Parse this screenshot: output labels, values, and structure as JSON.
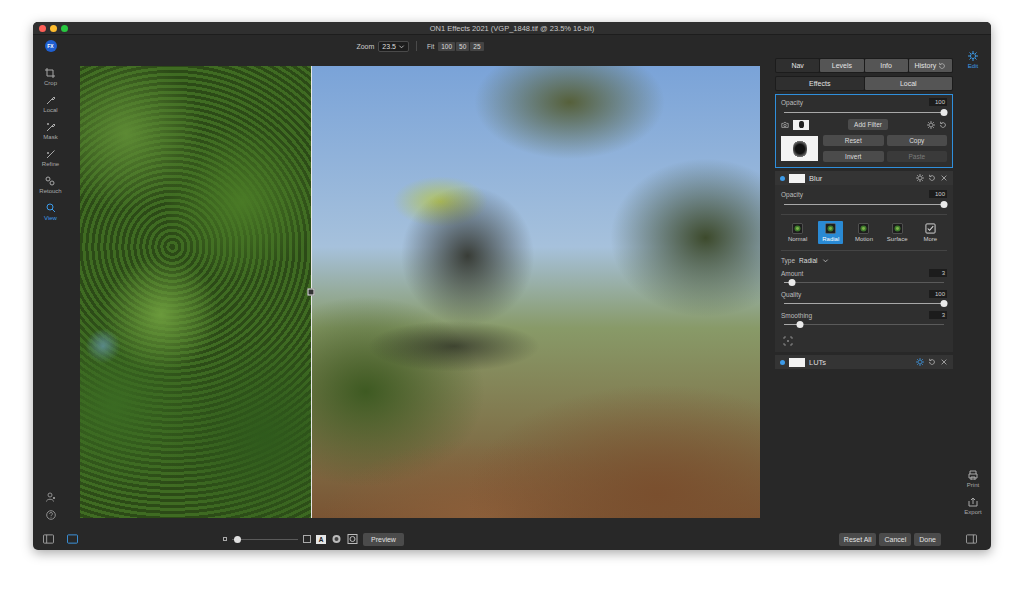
{
  "window": {
    "title": "ON1 Effects 2021 (VGP_1848.tif @ 23.5% 16-bit)"
  },
  "logo": "FX",
  "toolbar": {
    "zoom_label": "Zoom",
    "zoom_value": "23.5",
    "fit_label": "Fit",
    "presets": [
      "100",
      "50",
      "25"
    ]
  },
  "tools": [
    {
      "label": "Crop",
      "selected": false
    },
    {
      "label": "Local",
      "selected": false
    },
    {
      "label": "Mask",
      "selected": false
    },
    {
      "label": "Refine",
      "selected": false
    },
    {
      "label": "Retouch",
      "selected": false
    },
    {
      "label": "View",
      "selected": true
    }
  ],
  "modules": [
    {
      "label": "Edit",
      "selected": true
    },
    {
      "label": "Print",
      "selected": false
    },
    {
      "label": "Export",
      "selected": false
    }
  ],
  "photo": {
    "split_level": 0.34
  },
  "panel_tabs": [
    {
      "label": "Nav",
      "selected": true
    },
    {
      "label": "Levels",
      "selected": false
    },
    {
      "label": "Info",
      "selected": false
    },
    {
      "label": "History",
      "selected": false
    }
  ],
  "mode_tabs": [
    {
      "label": "Effects",
      "selected": true
    },
    {
      "label": "Local",
      "selected": false
    }
  ],
  "master": {
    "opacity": {
      "label": "Opacity",
      "value": "100",
      "level": 1
    },
    "add_filter": "Add Filter",
    "buttons": [
      {
        "label": "Reset",
        "disabled": false
      },
      {
        "label": "Copy",
        "disabled": false
      },
      {
        "label": "Invert",
        "disabled": false
      },
      {
        "label": "Paste",
        "disabled": true
      }
    ]
  },
  "filters": [
    {
      "name": "Blur",
      "enabled": true,
      "expanded": true,
      "opacity": {
        "label": "Opacity",
        "value": "100",
        "level": 1
      },
      "types": [
        {
          "label": "Normal",
          "selected": false,
          "kind": "preset"
        },
        {
          "label": "Radial",
          "selected": true,
          "kind": "preset"
        },
        {
          "label": "Motion",
          "selected": false,
          "kind": "preset"
        },
        {
          "label": "Surface",
          "selected": false,
          "kind": "preset"
        },
        {
          "label": "More",
          "selected": false,
          "kind": "menu"
        }
      ],
      "type_field": {
        "label": "Type",
        "value": "Radial"
      },
      "sliders": [
        {
          "label": "Amount",
          "value": "3",
          "level": 0.05
        },
        {
          "label": "Quality",
          "value": "100",
          "level": 1
        },
        {
          "label": "Smoothing",
          "value": "3",
          "level": 0.1
        }
      ]
    },
    {
      "name": "LUTs",
      "enabled": true,
      "expanded": false
    }
  ],
  "bottom_bar": {
    "panel_toggles": [
      {
        "selected": false
      },
      {
        "selected": true
      }
    ],
    "mask_letter": "A",
    "preview": "Preview",
    "buttons": [
      "Reset All",
      "Cancel",
      "Done"
    ]
  }
}
